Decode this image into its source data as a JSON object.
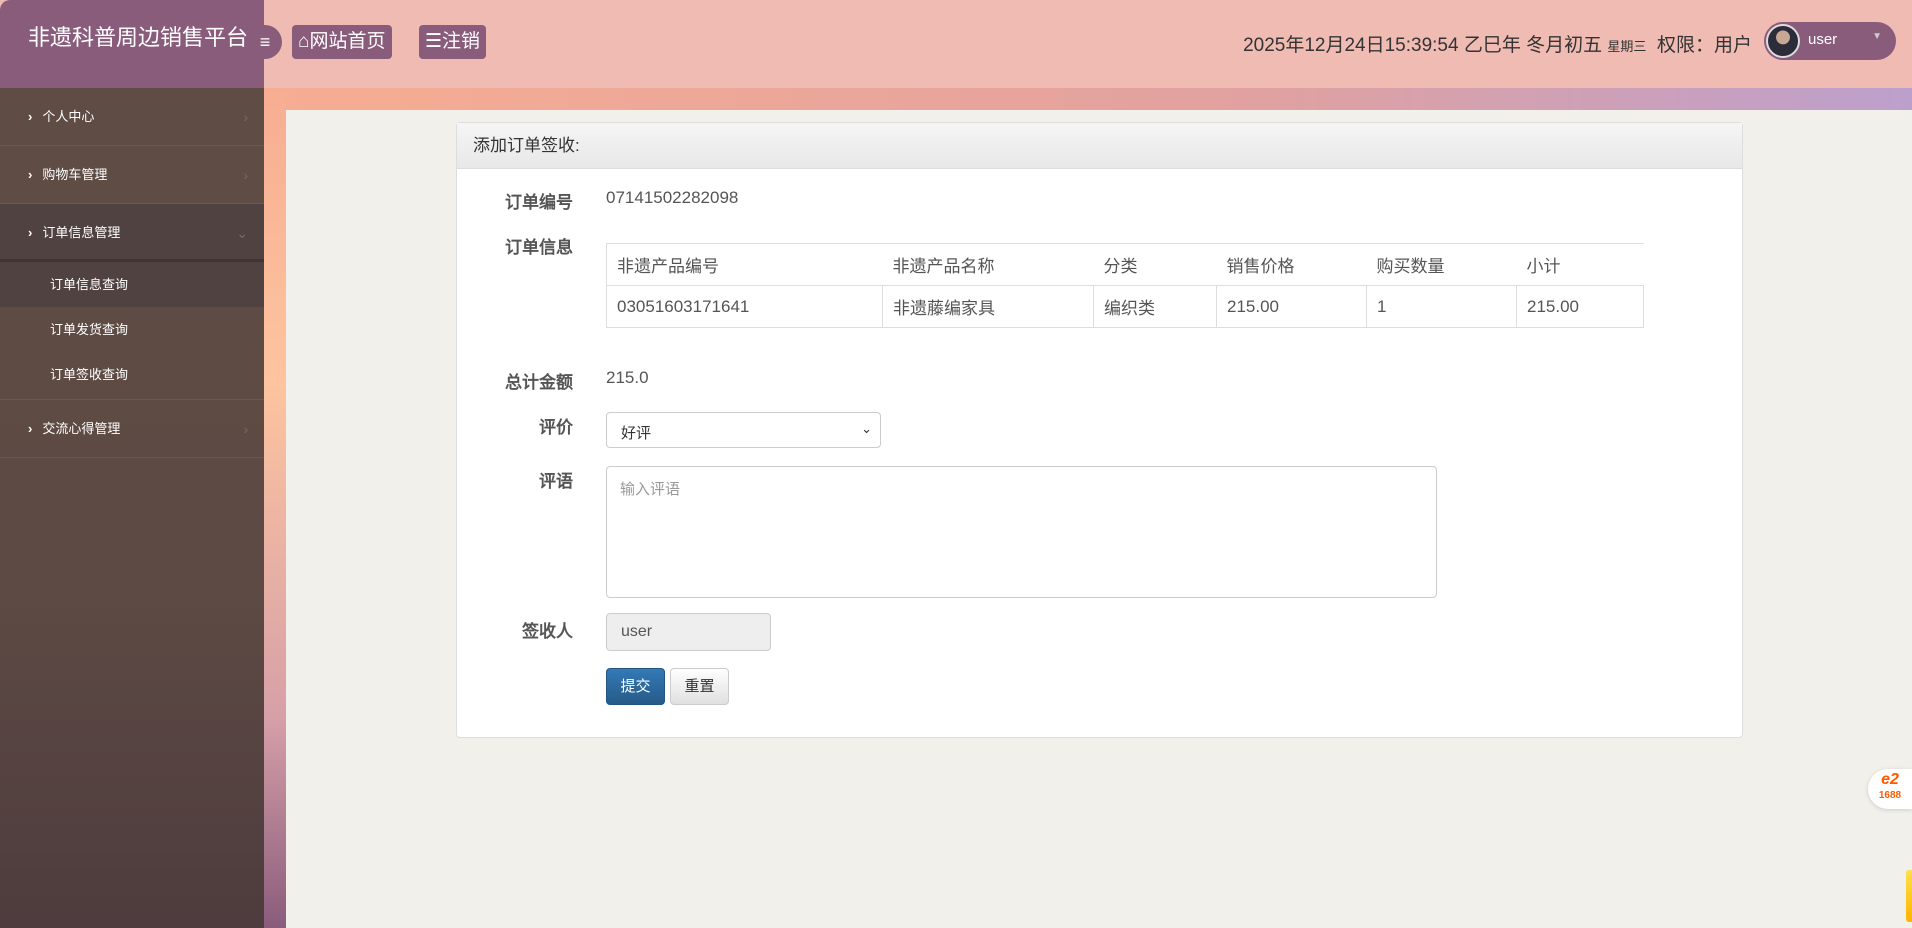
{
  "header": {
    "brand": "非遗科普周边销售平台",
    "toggle_icon": "≡",
    "home_label": "网站首页",
    "logout_label": "注销",
    "datetime": "2025年12月24日15:39:54 乙巳年 冬月初五",
    "weekday": "星期三",
    "role": "权限：用户",
    "username": "user"
  },
  "sidebar": {
    "items": [
      {
        "label": "个人中心"
      },
      {
        "label": "购物车管理"
      },
      {
        "label": "订单信息管理",
        "children": [
          "订单信息查询",
          "订单发货查询",
          "订单签收查询"
        ]
      },
      {
        "label": "交流心得管理"
      }
    ]
  },
  "form": {
    "title": "添加订单签收:",
    "order_no_label": "订单编号",
    "order_no": "07141502282098",
    "order_info_label": "订单信息",
    "table": {
      "headers": [
        "非遗产品编号",
        "非遗产品名称",
        "分类",
        "销售价格",
        "购买数量",
        "小计"
      ],
      "rows": [
        [
          "03051603171641",
          "非遗藤编家具",
          "编织类",
          "215.00",
          "1",
          "215.00"
        ]
      ]
    },
    "total_label": "总计金额",
    "total": "215.0",
    "rating_label": "评价",
    "rating_value": "好评",
    "comment_label": "评语",
    "comment_placeholder": "输入评语",
    "receiver_label": "签收人",
    "receiver": "user",
    "submit": "提交",
    "reset": "重置"
  },
  "widget": {
    "badge": "1688"
  }
}
